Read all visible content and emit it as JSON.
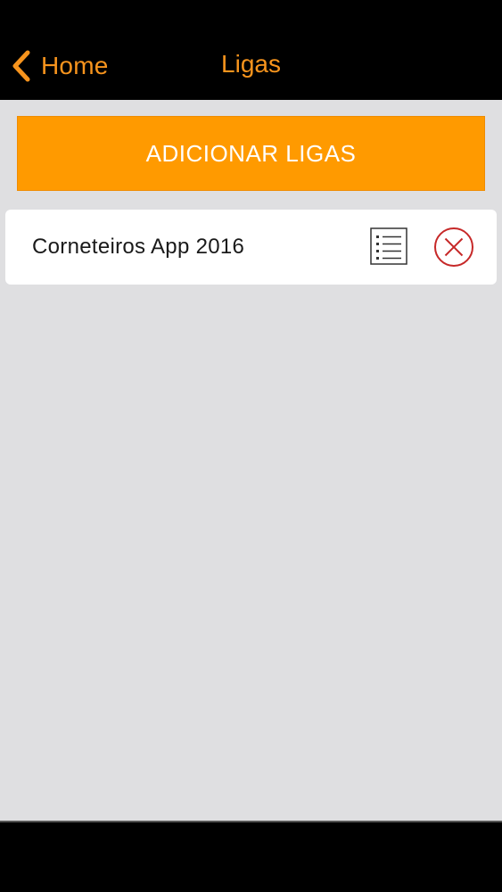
{
  "navbar": {
    "back_label": "Home",
    "title": "Ligas",
    "accent_color": "#f7941d"
  },
  "main": {
    "add_button_label": "ADICIONAR LIGAS",
    "add_button_color": "#ff9a00",
    "background_color": "#dfdfe1",
    "leagues": [
      {
        "name": "Corneteiros App 2016",
        "actions": [
          "list-icon",
          "close-circle-icon"
        ],
        "delete_color": "#c62828"
      }
    ]
  }
}
